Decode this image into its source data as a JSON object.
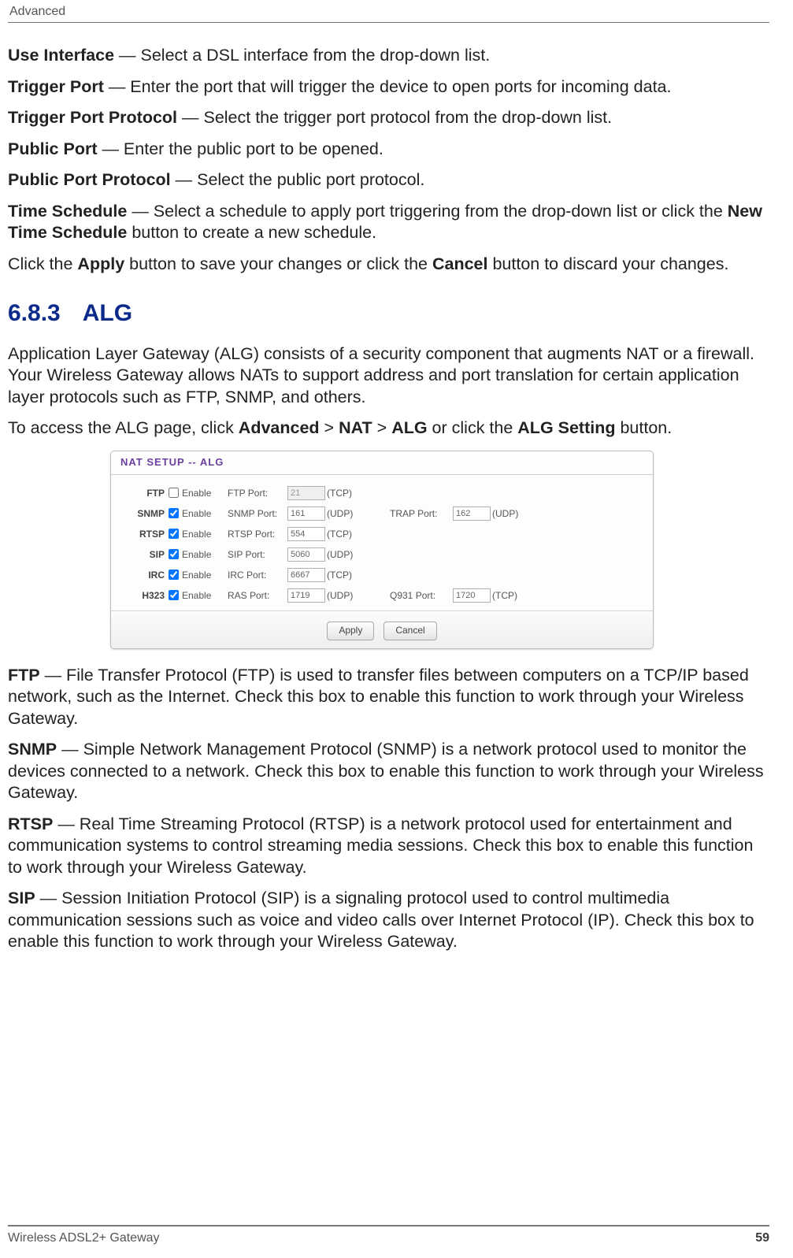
{
  "header": "Advanced",
  "defs": {
    "use_interface": {
      "term": "Use Interface",
      "text": " — Select a DSL interface from the drop-down list."
    },
    "trigger_port": {
      "term": "Trigger Port",
      "text": " — Enter the port that will trigger the device to open ports for incoming data."
    },
    "trigger_port_protocol": {
      "term": "Trigger Port Protocol",
      "text": " — Select the trigger port protocol from the drop-down list."
    },
    "public_port": {
      "term": "Public Port",
      "text": " — Enter the public port to be opened."
    },
    "public_port_protocol": {
      "term": "Public Port Protocol",
      "text": " — Select the public port protocol."
    },
    "time_schedule": {
      "term": "Time Schedule",
      "text1": " — Select a schedule to apply port triggering from the drop-down list or click the ",
      "bold1": "New Time Schedule",
      "text2": " button to create a new schedule."
    },
    "apply_sentence": {
      "pre": "Click the ",
      "apply": "Apply",
      "mid": " button to save your changes or click the ",
      "cancel": "Cancel",
      "post": " button to discard your changes."
    }
  },
  "section": {
    "num": "6.8.3",
    "title": "ALG"
  },
  "alg_intro": "Application Layer Gateway (ALG) consists of a security component that augments NAT or a firewall. Your Wireless Gateway allows NATs to support address and port translation for certain application layer protocols such as FTP, SNMP, and others.",
  "alg_access": {
    "pre": "To access the ALG page, click ",
    "path1": "Advanced",
    "sep": " > ",
    "path2": "NAT",
    "path3": "ALG",
    "mid": " or click the ",
    "btn": "ALG Setting",
    "post": " button."
  },
  "panel": {
    "title": "NAT SETUP  --  ALG",
    "enable": "Enable",
    "apply": "Apply",
    "cancel": "Cancel",
    "rows": {
      "ftp": {
        "label": "FTP",
        "checked": false,
        "portlabel": "FTP Port:",
        "port": "21",
        "proto": "(TCP)"
      },
      "snmp": {
        "label": "SNMP",
        "checked": true,
        "portlabel": "SNMP Port:",
        "port": "161",
        "proto": "(UDP)",
        "port2label": "TRAP Port:",
        "port2": "162",
        "proto2": "(UDP)"
      },
      "rtsp": {
        "label": "RTSP",
        "checked": true,
        "portlabel": "RTSP Port:",
        "port": "554",
        "proto": "(TCP)"
      },
      "sip": {
        "label": "SIP",
        "checked": true,
        "portlabel": "SIP Port:",
        "port": "5060",
        "proto": "(UDP)"
      },
      "irc": {
        "label": "IRC",
        "checked": true,
        "portlabel": "IRC Port:",
        "port": "6667",
        "proto": "(TCP)"
      },
      "h323": {
        "label": "H323",
        "checked": true,
        "portlabel": "RAS Port:",
        "port": "1719",
        "proto": "(UDP)",
        "port2label": "Q931 Port:",
        "port2": "1720",
        "proto2": "(TCP)"
      }
    }
  },
  "desc": {
    "ftp": {
      "term": "FTP",
      "text": " — File Transfer Protocol (FTP) is used to transfer files between computers on a TCP/IP based network, such as the Internet. Check this box to enable this function to work through your Wireless Gateway."
    },
    "snmp": {
      "term": "SNMP",
      "text": " — Simple Network Management Protocol (SNMP) is a network protocol used to monitor the devices connected to a network. Check this box to enable this function to work through your Wireless Gateway."
    },
    "rtsp": {
      "term": "RTSP",
      "text": " — Real Time Streaming Protocol (RTSP) is a network protocol used for entertainment and communication systems to control streaming media sessions. Check this box to enable this function to work through your Wireless Gateway."
    },
    "sip": {
      "term": "SIP",
      "text": " — Session Initiation Protocol (SIP) is a signaling protocol used to control multimedia communication sessions such as voice and video calls over Internet Protocol (IP). Check this box to enable this function to work through your Wireless Gateway."
    }
  },
  "footer": {
    "left": "Wireless ADSL2+ Gateway",
    "page": "59"
  }
}
